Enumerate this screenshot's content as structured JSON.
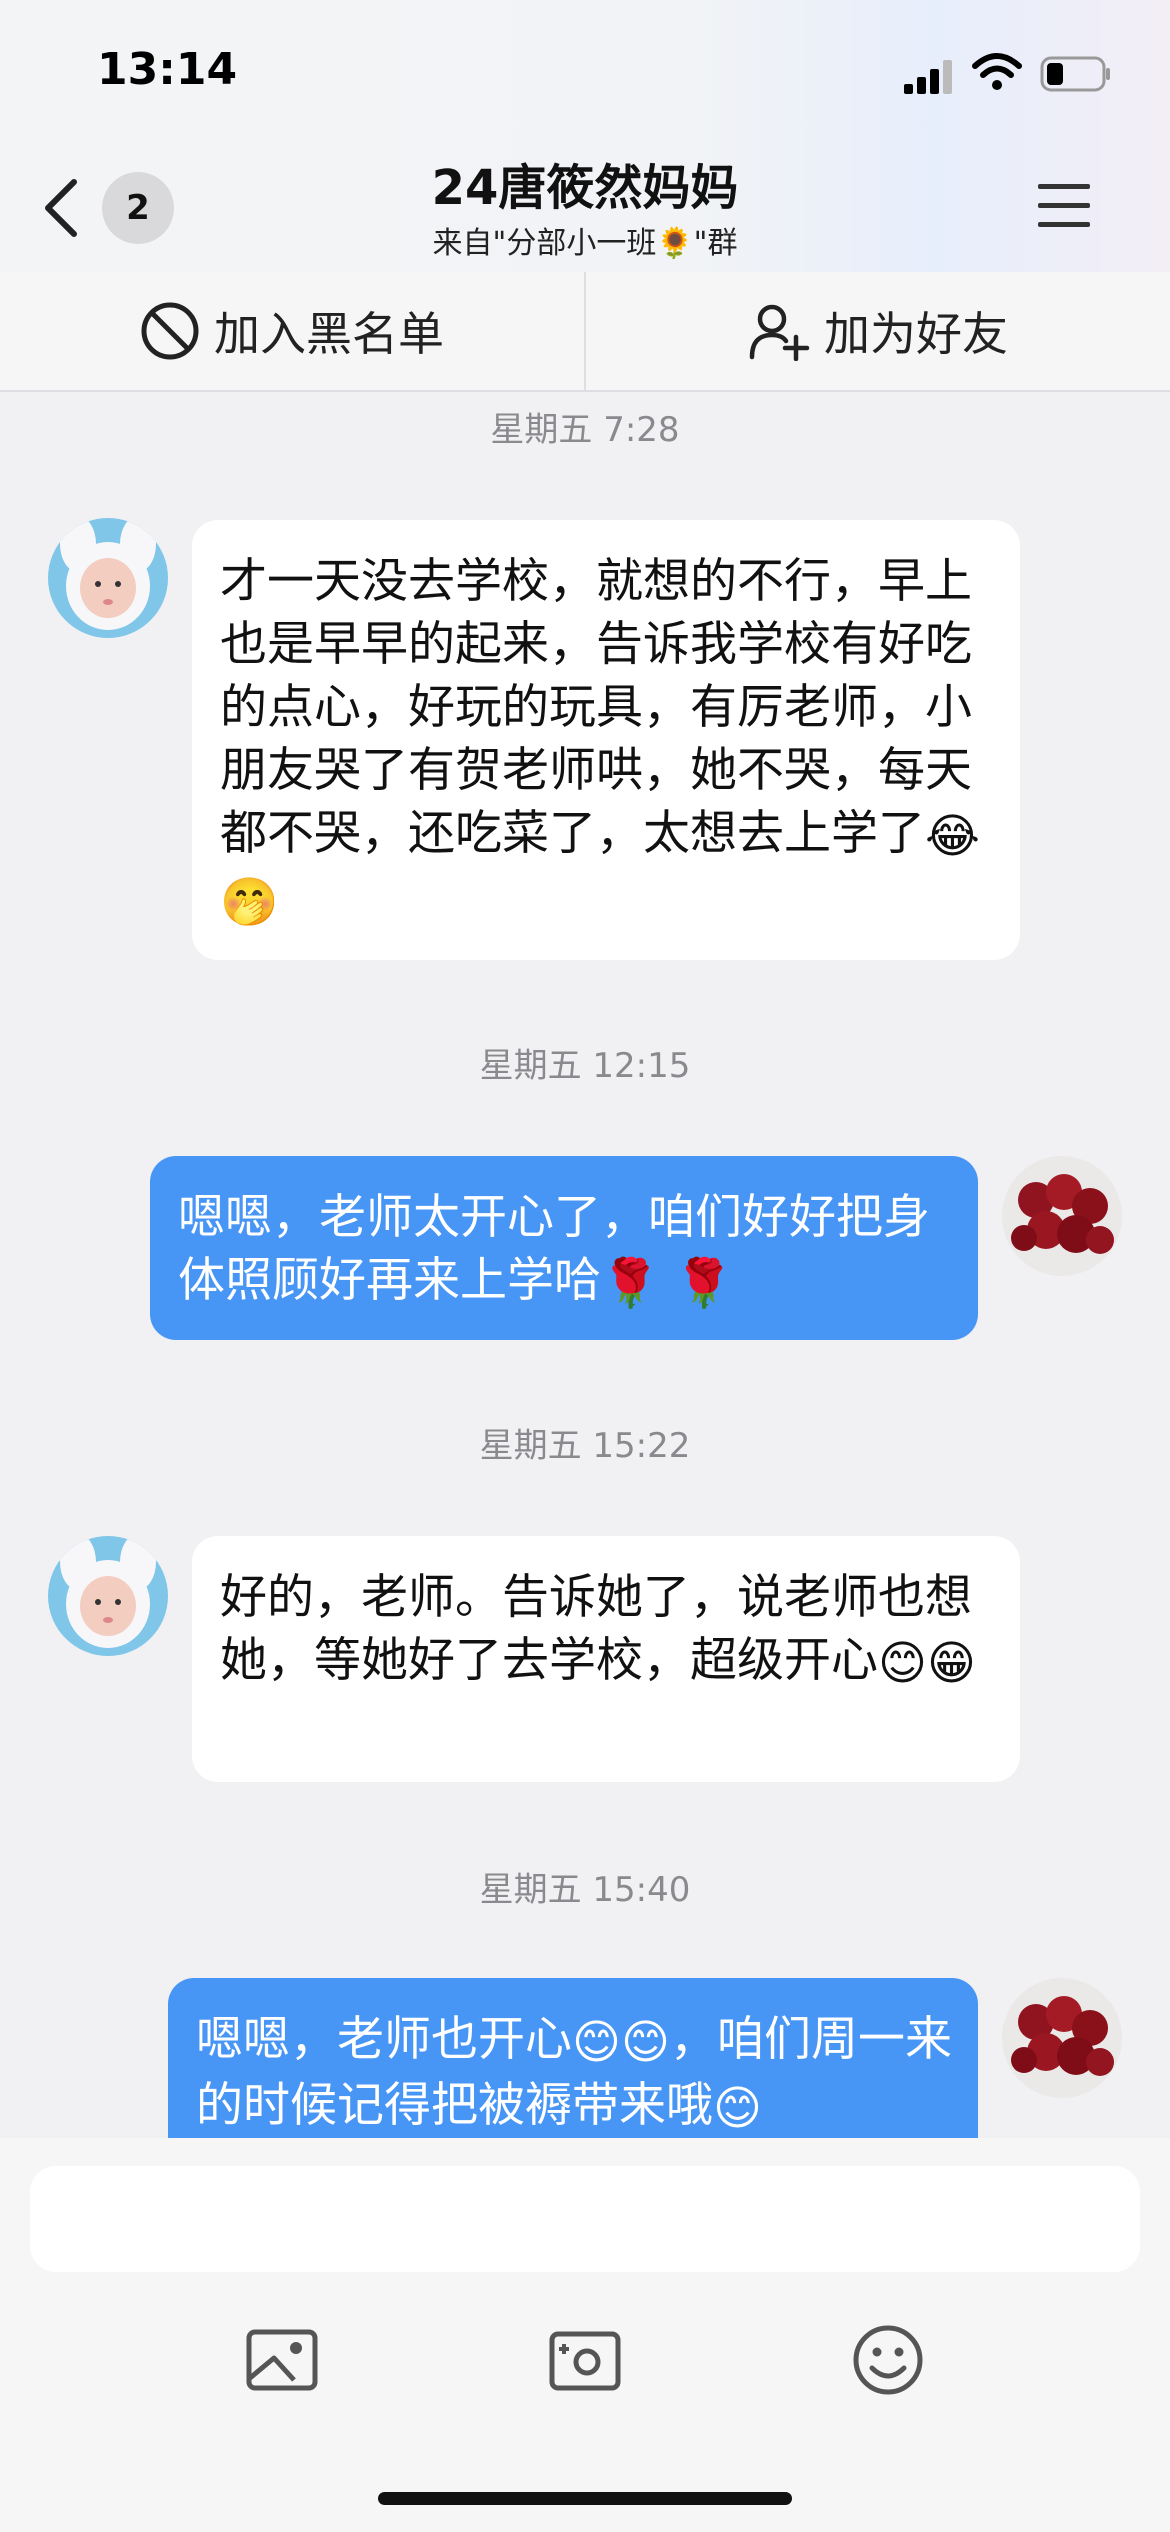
{
  "status_bar": {
    "time": "13:14"
  },
  "header": {
    "back_badge": "2",
    "title": "24唐筱然妈妈",
    "subtitle": "来自\"分部小一班🌻\"群"
  },
  "actions": {
    "blacklist": "加入黑名单",
    "add_friend": "加为好友"
  },
  "messages": [
    {
      "time": "星期五 7:28",
      "side": "in",
      "text": "才一天没去学校，就想的不行，早上也是早早的起来，告诉我学校有好吃的点心，好玩的玩具，有厉老师，小朋友哭了有贺老师哄，她不哭，每天都不哭，还吃菜了，太想去上学了",
      "emojis": [
        "😂",
        "🤭"
      ]
    },
    {
      "time": "星期五 12:15",
      "side": "out",
      "text": "嗯嗯，老师太开心了，咱们好好把身体照顾好再来上学哈",
      "emojis": [
        "🌹",
        "🌹"
      ]
    },
    {
      "time": "星期五 15:22",
      "side": "in",
      "text": "好的，老师。告诉她了，说老师也想她，等她好了去学校，超级开心",
      "emojis": [
        "😊",
        "😁"
      ]
    },
    {
      "time": "星期五 15:40",
      "side": "out",
      "text_a": "嗯嗯，老师也开心",
      "emojis_a": [
        "😊",
        "😊"
      ],
      "text_b": "，咱们周一来的时候记得把被褥带来哦",
      "emojis_b": [
        "😊"
      ]
    }
  ],
  "input": {
    "placeholder": ""
  },
  "toolbar": {
    "icons": [
      "photo-icon",
      "camera-icon",
      "emoji-icon"
    ]
  },
  "colors": {
    "outgoing_bubble": "#4795f5",
    "incoming_bubble": "#ffffff"
  }
}
